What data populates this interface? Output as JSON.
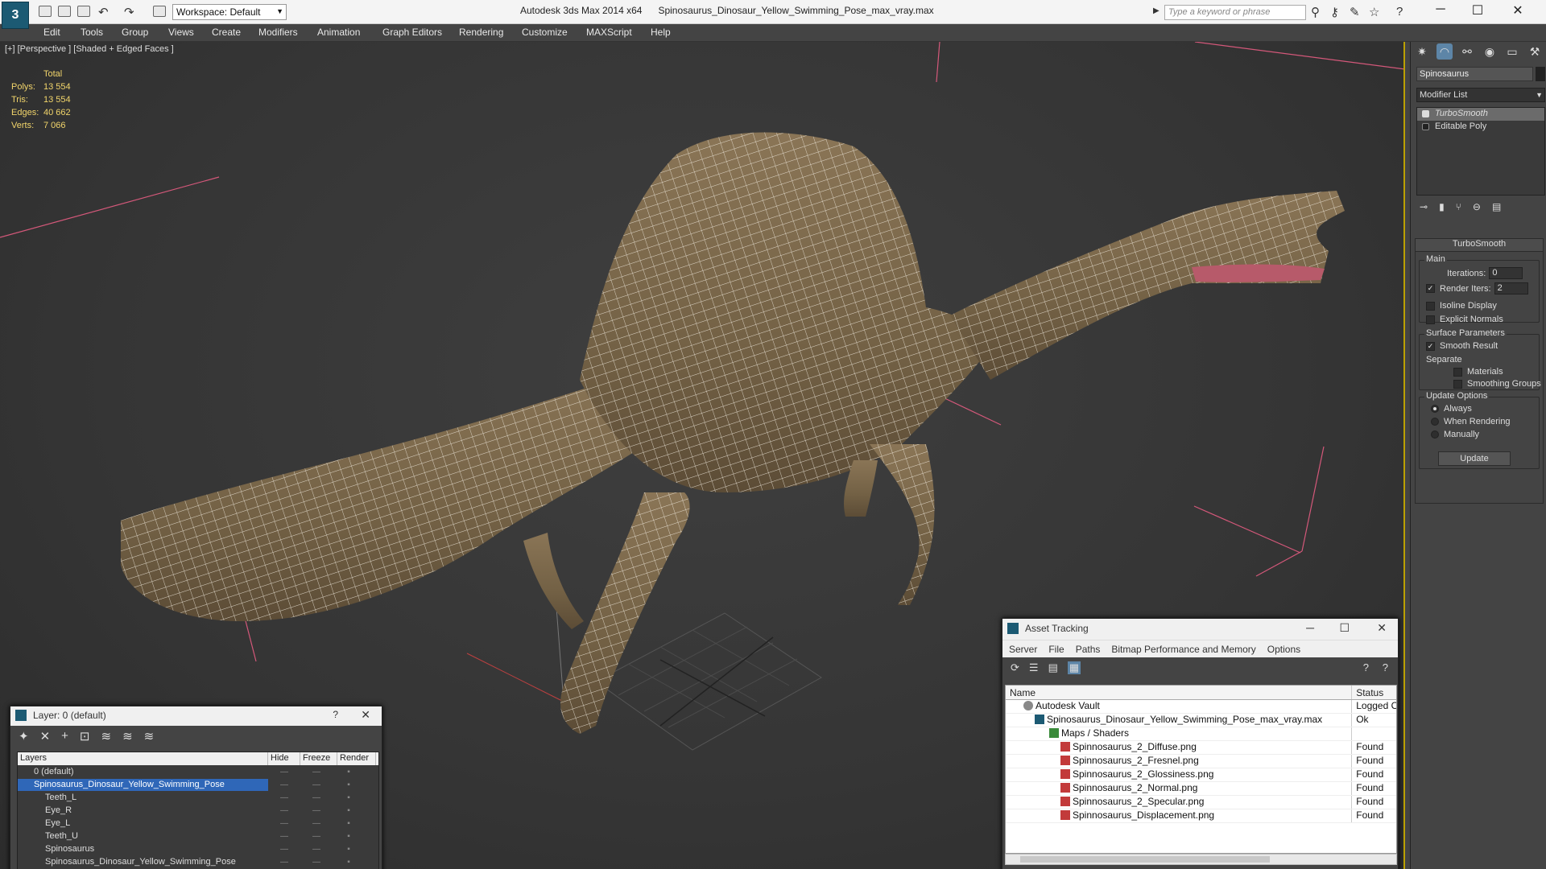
{
  "titlebar": {
    "workspace": "Workspace: Default",
    "app_title": "Autodesk 3ds Max  2014 x64",
    "file_title": "Spinosaurus_Dinosaur_Yellow_Swimming_Pose_max_vray.max",
    "search_placeholder": "Type a keyword or phrase"
  },
  "menu": [
    "Edit",
    "Tools",
    "Group",
    "Views",
    "Create",
    "Modifiers",
    "Animation",
    "Graph Editors",
    "Rendering",
    "Customize",
    "MAXScript",
    "Help"
  ],
  "viewport": {
    "label": "[+] [Perspective ] [Shaded + Edged Faces ]",
    "stats": {
      "header": "Total",
      "rows": [
        {
          "k": "Polys:",
          "v": "13 554"
        },
        {
          "k": "Tris:",
          "v": "13 554"
        },
        {
          "k": "Edges:",
          "v": "40 662"
        },
        {
          "k": "Verts:",
          "v": "7 066"
        }
      ]
    }
  },
  "command_panel": {
    "object_name": "Spinosaurus",
    "modifier_list": "Modifier List",
    "stack": [
      "TurboSmooth",
      "Editable Poly"
    ],
    "rollout_title": "TurboSmooth",
    "main_label": "Main",
    "iterations_label": "Iterations:",
    "iterations_value": "0",
    "render_iters_label": "Render Iters:",
    "render_iters_value": "2",
    "isoline": "Isoline Display",
    "explicit_normals": "Explicit Normals",
    "surface_params": "Surface Parameters",
    "smooth_result": "Smooth Result",
    "separate": "Separate",
    "materials": "Materials",
    "smoothing_groups": "Smoothing Groups",
    "update_options": "Update Options",
    "always": "Always",
    "when_rendering": "When Rendering",
    "manually": "Manually",
    "update_btn": "Update"
  },
  "layer_window": {
    "title": "Layer: 0 (default)",
    "help": "?",
    "headers": [
      "Layers",
      "Hide",
      "Freeze",
      "Render"
    ],
    "rows": [
      {
        "name": "0 (default)",
        "selected": false
      },
      {
        "name": "Spinosaurus_Dinosaur_Yellow_Swimming_Pose",
        "selected": true
      },
      {
        "name": "Teeth_L",
        "selected": false
      },
      {
        "name": "Eye_R",
        "selected": false
      },
      {
        "name": "Eye_L",
        "selected": false
      },
      {
        "name": "Teeth_U",
        "selected": false
      },
      {
        "name": "Spinosaurus",
        "selected": false
      },
      {
        "name": "Spinosaurus_Dinosaur_Yellow_Swimming_Pose",
        "selected": false
      }
    ]
  },
  "asset_window": {
    "title": "Asset Tracking",
    "menu": [
      "Server",
      "File",
      "Paths",
      "Bitmap Performance and Memory",
      "Options"
    ],
    "headers": [
      "Name",
      "Status"
    ],
    "rows": [
      {
        "name": "Autodesk Vault",
        "status": "Logged O"
      },
      {
        "name": "Spinosaurus_Dinosaur_Yellow_Swimming_Pose_max_vray.max",
        "status": "Ok"
      },
      {
        "name": "Maps / Shaders",
        "status": ""
      },
      {
        "name": "Spinnosaurus_2_Diffuse.png",
        "status": "Found"
      },
      {
        "name": "Spinnosaurus_2_Fresnel.png",
        "status": "Found"
      },
      {
        "name": "Spinnosaurus_2_Glossiness.png",
        "status": "Found"
      },
      {
        "name": "Spinnosaurus_2_Normal.png",
        "status": "Found"
      },
      {
        "name": "Spinnosaurus_2_Specular.png",
        "status": "Found"
      },
      {
        "name": "Spinnosaurus_Displacement.png",
        "status": "Found"
      }
    ]
  }
}
